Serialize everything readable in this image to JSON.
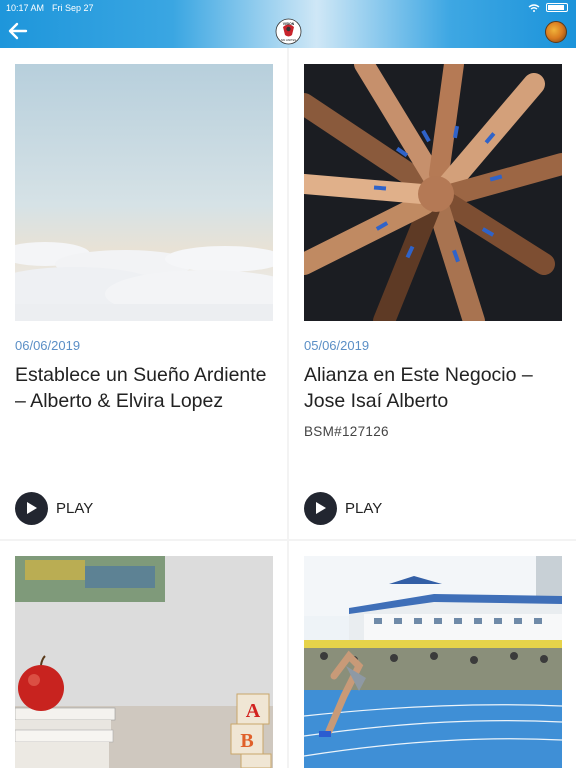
{
  "status_bar": {
    "time": "10:17 AM",
    "date": "Fri Sep 27"
  },
  "header": {
    "logo_text": "VISION",
    "logo_sub": "SIN LIMITES"
  },
  "cards": [
    {
      "date": "06/06/2019",
      "title": "Establece un Sueño Ardiente – Alberto & Elvira Lopez",
      "subtitle": "",
      "play_label": "PLAY",
      "image": "sky-clouds"
    },
    {
      "date": "05/06/2019",
      "title": "Alianza en Este Negocio – Jose Isaí Alberto",
      "subtitle": "BSM#127126",
      "play_label": "PLAY",
      "image": "team-hands"
    },
    {
      "image": "apple-books-blocks",
      "block_letters": [
        "A",
        "B"
      ]
    },
    {
      "image": "running-track"
    }
  ],
  "colors": {
    "header_blue": "#1e96db",
    "date_blue": "#5b8fc6",
    "play_dark": "#222630"
  }
}
